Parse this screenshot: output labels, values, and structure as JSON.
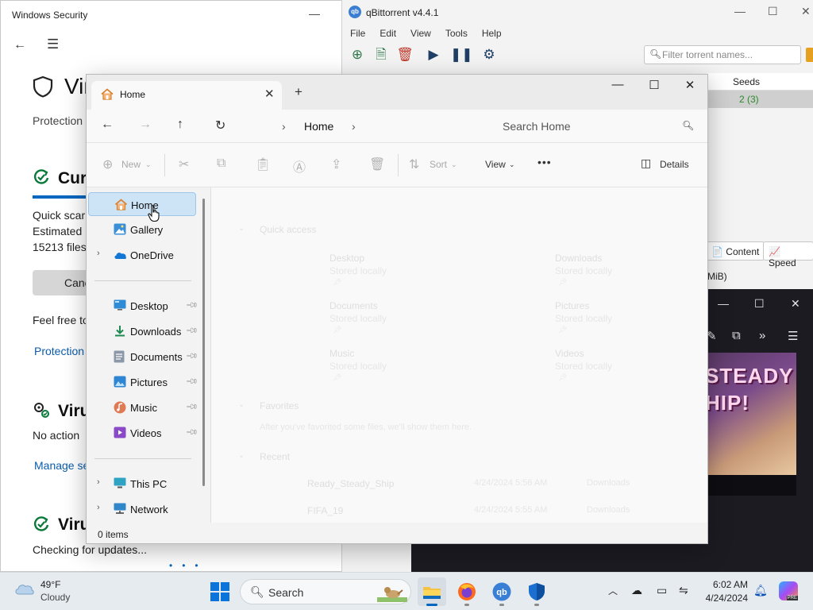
{
  "windows_security": {
    "title": "Windows Security",
    "heading": "Vir",
    "protection_line": "Protection",
    "current_title": "Curr",
    "scan_lines": [
      "Quick scar",
      "Estimated",
      "15213 files"
    ],
    "cancel_label": "Cance",
    "feel_free": "Feel free to",
    "protection_link": "Protection",
    "virus_title_1": "Viru",
    "no_action": "No action",
    "manage_link": "Manage se",
    "virus_title_2": "Viru",
    "checking": "Checking for updates..."
  },
  "qbittorrent": {
    "title": "qBittorrent v4.4.1",
    "menu": [
      "File",
      "Edit",
      "View",
      "Tools",
      "Help"
    ],
    "filter_placeholder": "Filter torrent names...",
    "seeds_header": "Seeds",
    "seeds_value": "2 (3)",
    "content_label": "Content",
    "speed_label": "Speed",
    "mib_label": "MiB)"
  },
  "firefox": {
    "art_text_1": "STEADY",
    "art_text_2": "HIP!"
  },
  "explorer": {
    "tab_label": "Home",
    "breadcrumb": "Home",
    "search_placeholder": "Search Home",
    "cmd_new": "New",
    "cmd_sort": "Sort",
    "cmd_view": "View",
    "cmd_more": "•••",
    "cmd_details": "Details",
    "sidebar": [
      {
        "label": "Home",
        "icon": "home-icon"
      },
      {
        "label": "Gallery",
        "icon": "gallery-icon"
      },
      {
        "label": "OneDrive",
        "icon": "onedrive-icon"
      },
      {
        "label": "Desktop",
        "icon": "desktop-icon"
      },
      {
        "label": "Downloads",
        "icon": "downloads-icon"
      },
      {
        "label": "Documents",
        "icon": "documents-icon"
      },
      {
        "label": "Pictures",
        "icon": "pictures-icon"
      },
      {
        "label": "Music",
        "icon": "music-icon"
      },
      {
        "label": "Videos",
        "icon": "videos-icon"
      },
      {
        "label": "This PC",
        "icon": "this-pc-icon"
      },
      {
        "label": "Network",
        "icon": "network-icon"
      }
    ],
    "status": "0 items",
    "content": {
      "quick_access": "Quick access",
      "quick_items": [
        {
          "name": "Desktop",
          "sub": "Stored locally"
        },
        {
          "name": "Downloads",
          "sub": "Stored locally"
        },
        {
          "name": "Documents",
          "sub": "Stored locally"
        },
        {
          "name": "Pictures",
          "sub": "Stored locally"
        },
        {
          "name": "Music",
          "sub": "Stored locally"
        },
        {
          "name": "Videos",
          "sub": "Stored locally"
        }
      ],
      "favorites": "Favorites",
      "favorites_hint": "After you've favorited some files, we'll show them here.",
      "recent": "Recent",
      "recent_items": [
        {
          "name": "Ready_Steady_Ship",
          "date": "4/24/2024 5:56 AM",
          "location": "Downloads"
        },
        {
          "name": "FIFA_19",
          "date": "4/24/2024 5:55 AM",
          "location": "Downloads"
        }
      ]
    }
  },
  "taskbar": {
    "temp": "49°F",
    "condition": "Cloudy",
    "search_label": "Search",
    "time": "6:02 AM",
    "date": "4/24/2024",
    "accent": "#0067c0"
  }
}
